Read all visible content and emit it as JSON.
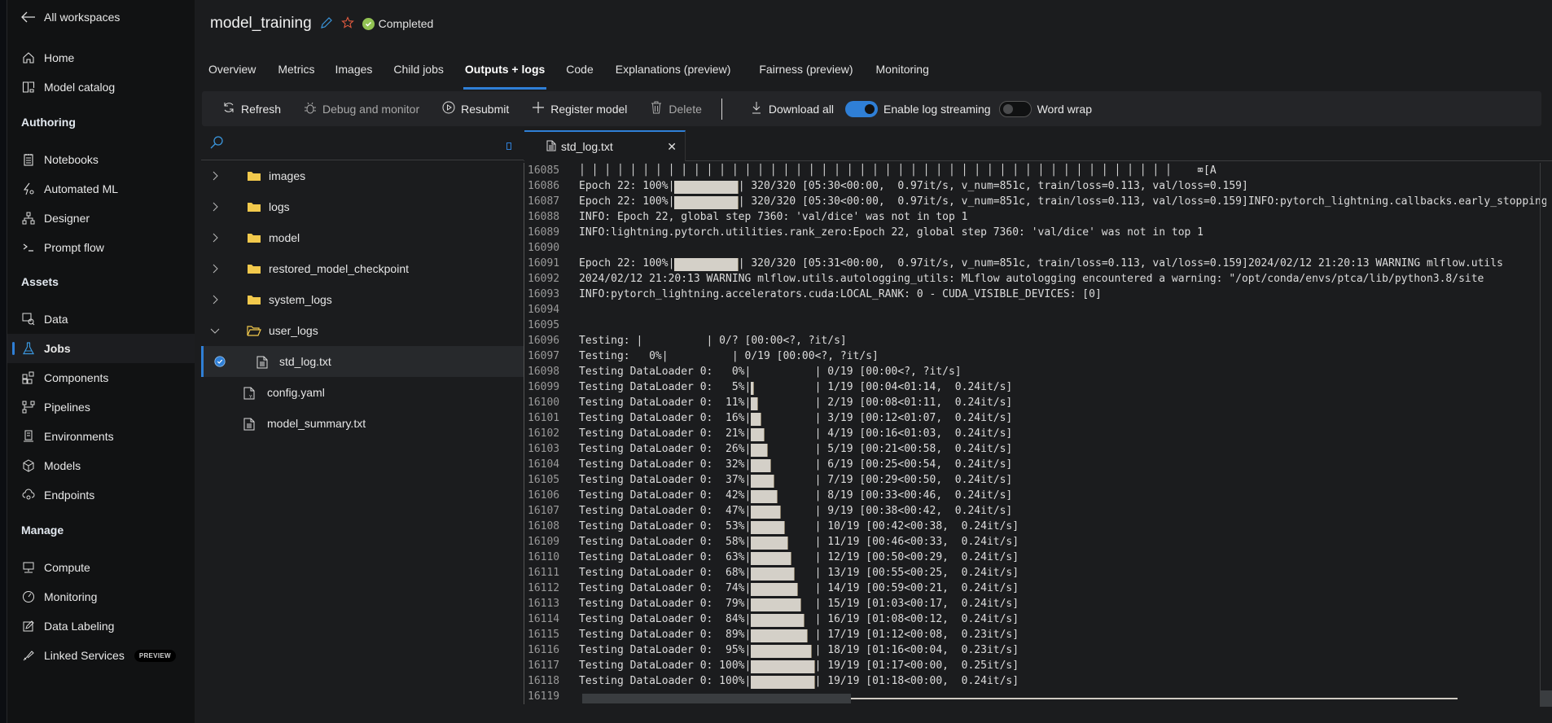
{
  "sidebar": {
    "back_label": "All workspaces",
    "top_items": [
      {
        "label": "Home",
        "icon": "home-icon"
      },
      {
        "label": "Model catalog",
        "icon": "model-catalog-icon"
      }
    ],
    "sections": [
      {
        "title": "Authoring",
        "items": [
          {
            "label": "Notebooks",
            "icon": "notebook-icon"
          },
          {
            "label": "Automated ML",
            "icon": "automated-ml-icon"
          },
          {
            "label": "Designer",
            "icon": "designer-icon"
          },
          {
            "label": "Prompt flow",
            "icon": "prompt-flow-icon"
          }
        ]
      },
      {
        "title": "Assets",
        "items": [
          {
            "label": "Data",
            "icon": "data-icon"
          },
          {
            "label": "Jobs",
            "icon": "flask-icon",
            "active": true
          },
          {
            "label": "Components",
            "icon": "components-icon"
          },
          {
            "label": "Pipelines",
            "icon": "pipelines-icon"
          },
          {
            "label": "Environments",
            "icon": "environments-icon"
          },
          {
            "label": "Models",
            "icon": "cube-icon"
          },
          {
            "label": "Endpoints",
            "icon": "endpoints-icon"
          }
        ]
      },
      {
        "title": "Manage",
        "items": [
          {
            "label": "Compute",
            "icon": "compute-icon"
          },
          {
            "label": "Monitoring",
            "icon": "gauge-icon"
          },
          {
            "label": "Data Labeling",
            "icon": "edit-icon"
          },
          {
            "label": "Linked Services",
            "icon": "link-icon",
            "badge": "PREVIEW"
          }
        ]
      }
    ]
  },
  "header": {
    "title": "model_training",
    "status": "Completed",
    "colors": {
      "accent": "#2f7fd6",
      "success": "#92c353",
      "star": "#e05a3f"
    }
  },
  "tabs": [
    {
      "label": "Overview"
    },
    {
      "label": "Metrics"
    },
    {
      "label": "Images"
    },
    {
      "label": "Child jobs"
    },
    {
      "label": "Outputs + logs",
      "active": true
    },
    {
      "label": "Code"
    },
    {
      "label": "Explanations (preview)"
    },
    {
      "label": "Fairness (preview)"
    },
    {
      "label": "Monitoring"
    }
  ],
  "toolbar": {
    "refresh": "Refresh",
    "debug": "Debug and monitor",
    "resubmit": "Resubmit",
    "register": "Register model",
    "delete": "Delete",
    "download_all": "Download all",
    "log_streaming": {
      "label": "Enable log streaming",
      "on": true
    },
    "word_wrap": {
      "label": "Word wrap",
      "on": false
    }
  },
  "tree": {
    "items": [
      {
        "label": "images",
        "type": "folder",
        "expanded": false
      },
      {
        "label": "logs",
        "type": "folder",
        "expanded": false
      },
      {
        "label": "model",
        "type": "folder",
        "expanded": false
      },
      {
        "label": "restored_model_checkpoint",
        "type": "folder",
        "expanded": false
      },
      {
        "label": "system_logs",
        "type": "folder",
        "expanded": false
      },
      {
        "label": "user_logs",
        "type": "folder",
        "expanded": true
      },
      {
        "label": "std_log.txt",
        "type": "file",
        "selected": true,
        "indent": 1
      },
      {
        "label": "config.yaml",
        "type": "yaml"
      },
      {
        "label": "model_summary.txt",
        "type": "file"
      }
    ]
  },
  "editor": {
    "tab_label": "std_log.txt",
    "lines": [
      {
        "n": "16085",
        "t": "│ │ │ │ │ │ │ │ │ │ │ │ │ │ │ │ │ │ │ │ │ │ │ │ │ │ │ │ │ │ │ │ │ │ │ │ │ │ │ │ │ │ │ │ │ │ │    ⌧[A"
      },
      {
        "n": "16086",
        "pre": "Epoch 22: 100%|",
        "bar": 1.0,
        "post": "| 320/320 [05:30<00:00,  0.97it/s, v_num=851c, train/loss=0.113, val/loss=0.159]"
      },
      {
        "n": "16087",
        "pre": "Epoch 22: 100%|",
        "bar": 1.0,
        "post": "| 320/320 [05:30<00:00,  0.97it/s, v_num=851c, train/loss=0.113, val/loss=0.159]INFO:pytorch_lightning.callbacks.early_stopping"
      },
      {
        "n": "16088",
        "t": "INFO: Epoch 22, global step 7360: 'val/dice' was not in top 1"
      },
      {
        "n": "16089",
        "t": "INFO:lightning.pytorch.utilities.rank_zero:Epoch 22, global step 7360: 'val/dice' was not in top 1"
      },
      {
        "n": "16090",
        "t": ""
      },
      {
        "n": "16091",
        "pre": "Epoch 22: 100%|",
        "bar": 1.0,
        "post": "| 320/320 [05:31<00:00,  0.97it/s, v_num=851c, train/loss=0.113, val/loss=0.159]2024/02/12 21:20:13 WARNING mlflow.utils"
      },
      {
        "n": "16092",
        "t": "2024/02/12 21:20:13 WARNING mlflow.utils.autologging_utils: MLflow autologging encountered a warning: \"/opt/conda/envs/ptca/lib/python3.8/site"
      },
      {
        "n": "16093",
        "t": "INFO:pytorch_lightning.accelerators.cuda:LOCAL_RANK: 0 - CUDA_VISIBLE_DEVICES: [0]"
      },
      {
        "n": "16094",
        "t": ""
      },
      {
        "n": "16095",
        "t": ""
      },
      {
        "n": "16096",
        "t": "Testing: |          | 0/? [00:00<?, ?it/s]"
      },
      {
        "n": "16097",
        "t": "Testing:   0%|          | 0/19 [00:00<?, ?it/s]"
      },
      {
        "n": "16098",
        "pre": "Testing DataLoader 0:   0%|",
        "bar": 0.0,
        "post": "| 0/19 [00:00<?, ?it/s]"
      },
      {
        "n": "16099",
        "pre": "Testing DataLoader 0:   5%|",
        "bar": 0.05,
        "post": "| 1/19 [00:04<01:14,  0.24it/s]"
      },
      {
        "n": "16100",
        "pre": "Testing DataLoader 0:  11%|",
        "bar": 0.11,
        "post": "| 2/19 [00:08<01:11,  0.24it/s]"
      },
      {
        "n": "16101",
        "pre": "Testing DataLoader 0:  16%|",
        "bar": 0.16,
        "post": "| 3/19 [00:12<01:07,  0.24it/s]"
      },
      {
        "n": "16102",
        "pre": "Testing DataLoader 0:  21%|",
        "bar": 0.21,
        "post": "| 4/19 [00:16<01:03,  0.24it/s]"
      },
      {
        "n": "16103",
        "pre": "Testing DataLoader 0:  26%|",
        "bar": 0.26,
        "post": "| 5/19 [00:21<00:58,  0.24it/s]"
      },
      {
        "n": "16104",
        "pre": "Testing DataLoader 0:  32%|",
        "bar": 0.32,
        "post": "| 6/19 [00:25<00:54,  0.24it/s]"
      },
      {
        "n": "16105",
        "pre": "Testing DataLoader 0:  37%|",
        "bar": 0.37,
        "post": "| 7/19 [00:29<00:50,  0.24it/s]"
      },
      {
        "n": "16106",
        "pre": "Testing DataLoader 0:  42%|",
        "bar": 0.42,
        "post": "| 8/19 [00:33<00:46,  0.24it/s]"
      },
      {
        "n": "16107",
        "pre": "Testing DataLoader 0:  47%|",
        "bar": 0.47,
        "post": "| 9/19 [00:38<00:42,  0.24it/s]"
      },
      {
        "n": "16108",
        "pre": "Testing DataLoader 0:  53%|",
        "bar": 0.53,
        "post": "| 10/19 [00:42<00:38,  0.24it/s]"
      },
      {
        "n": "16109",
        "pre": "Testing DataLoader 0:  58%|",
        "bar": 0.58,
        "post": "| 11/19 [00:46<00:33,  0.24it/s]"
      },
      {
        "n": "16110",
        "pre": "Testing DataLoader 0:  63%|",
        "bar": 0.63,
        "post": "| 12/19 [00:50<00:29,  0.24it/s]"
      },
      {
        "n": "16111",
        "pre": "Testing DataLoader 0:  68%|",
        "bar": 0.68,
        "post": "| 13/19 [00:55<00:25,  0.24it/s]"
      },
      {
        "n": "16112",
        "pre": "Testing DataLoader 0:  74%|",
        "bar": 0.74,
        "post": "| 14/19 [00:59<00:21,  0.24it/s]"
      },
      {
        "n": "16113",
        "pre": "Testing DataLoader 0:  79%|",
        "bar": 0.79,
        "post": "| 15/19 [01:03<00:17,  0.24it/s]"
      },
      {
        "n": "16114",
        "pre": "Testing DataLoader 0:  84%|",
        "bar": 0.84,
        "post": "| 16/19 [01:08<00:12,  0.24it/s]"
      },
      {
        "n": "16115",
        "pre": "Testing DataLoader 0:  89%|",
        "bar": 0.89,
        "post": "| 17/19 [01:12<00:08,  0.23it/s]"
      },
      {
        "n": "16116",
        "pre": "Testing DataLoader 0:  95%|",
        "bar": 0.95,
        "post": "| 18/19 [01:16<00:04,  0.23it/s]"
      },
      {
        "n": "16117",
        "pre": "Testing DataLoader 0: 100%|",
        "bar": 1.0,
        "post": "| 19/19 [01:17<00:00,  0.25it/s]"
      },
      {
        "n": "16118",
        "pre": "Testing DataLoader 0: 100%|",
        "bar": 1.0,
        "post": "| 19/19 [01:18<00:00,  0.24it/s]"
      },
      {
        "n": "16119",
        "t": ""
      }
    ]
  }
}
